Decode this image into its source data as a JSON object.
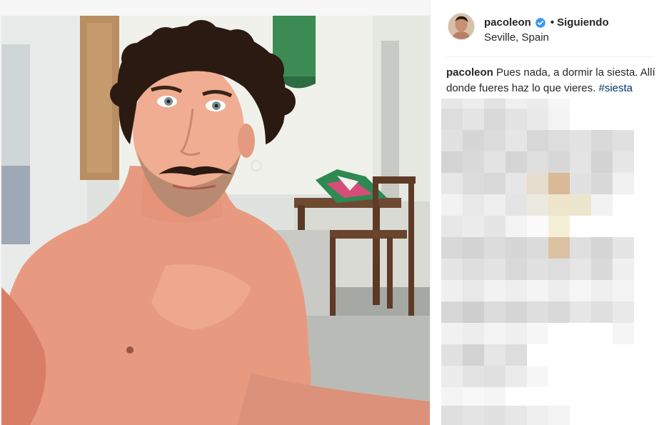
{
  "post": {
    "username": "pacoleon",
    "follow_status": "Siguiendo",
    "bullet": "•",
    "location": "Seville, Spain",
    "caption_user": "pacoleon",
    "caption_text": " Pues nada, a dormir la siesta. Allí donde fueres haz lo que vieres. ",
    "hashtag": "#siesta",
    "verified_badge_icon": "verified-badge-icon",
    "accent_color": "#3897f0",
    "hashtag_color": "#003569"
  },
  "comments": {
    "state": "pixelated"
  }
}
